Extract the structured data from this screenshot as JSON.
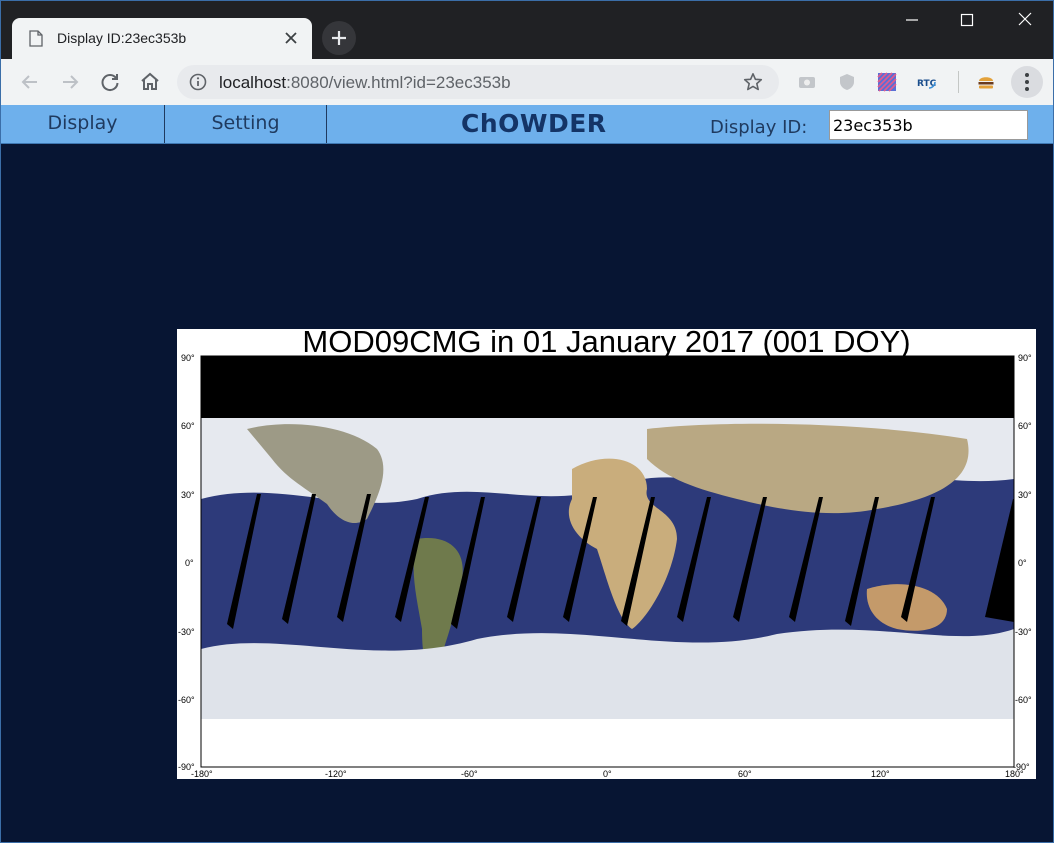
{
  "browser": {
    "tab_title": "Display ID:23ec353b",
    "url_host": "localhost",
    "url_rest": ":8080/view.html?id=23ec353b",
    "icons": {
      "tab_page": "page-icon",
      "tab_close": "close-icon",
      "new_tab": "plus-icon",
      "back": "back-arrow-icon",
      "forward": "forward-arrow-icon",
      "reload": "reload-icon",
      "home": "home-icon",
      "info": "info-icon",
      "bookmark": "star-icon",
      "menu": "kebab-menu-icon"
    },
    "extensions": [
      "extension-camera-icon",
      "extension-shield-icon",
      "extension-pattern-icon",
      "extension-rtc-icon",
      "extension-burger-icon"
    ]
  },
  "app": {
    "nav": [
      {
        "label": "Display"
      },
      {
        "label": "Setting"
      }
    ],
    "title": "ChOWDER",
    "display_id_label": "Display ID:",
    "display_id_value": "23ec353b",
    "colors": {
      "appbar": "#6eb0ec",
      "background": "#071533",
      "title": "#143466"
    }
  },
  "map": {
    "title": "MOD09CMG in 01 January 2017 (001 DOY)",
    "lat_labels": [
      "90°",
      "60°",
      "30°",
      "0°",
      "-30°",
      "-60°",
      "-90°"
    ],
    "lon_labels": [
      "-180°",
      "-120°",
      "-60°",
      "0°",
      "60°",
      "120°",
      "180°"
    ]
  }
}
